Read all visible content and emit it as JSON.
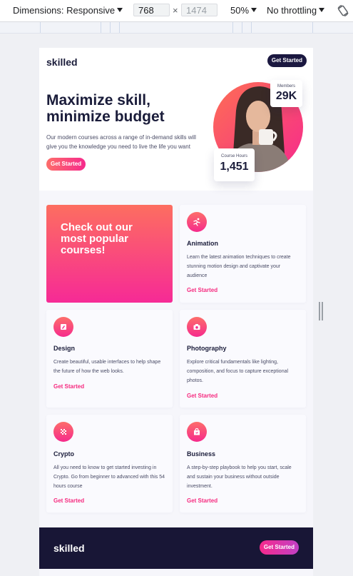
{
  "devtools": {
    "dimensions_label": "Dimensions: Responsive",
    "width_value": "768",
    "height_value": "1474",
    "times_symbol": "×",
    "zoom": "50%",
    "throttling": "No throttling"
  },
  "site": {
    "logo": "skilled",
    "header_cta": "Get Started"
  },
  "hero": {
    "title": "Maximize skill, minimize budget",
    "text": "Our modern courses across a range of in-demand skills will give you the knowledge you need to live the life you want",
    "cta": "Get Started",
    "stats": {
      "members_label": "Members",
      "members_value": "29K",
      "hours_label": "Course Hours",
      "hours_value": "1,451"
    }
  },
  "promo": {
    "title": "Check out our most popular courses!"
  },
  "courses": [
    {
      "title": "Animation",
      "text": "Learn the latest animation techniques to create stunning motion design and captivate your audience",
      "link": "Get Started"
    },
    {
      "title": "Design",
      "text": "Create beautiful, usable interfaces to help shape the future of how the web looks.",
      "link": "Get Started"
    },
    {
      "title": "Photography",
      "text": "Explore critical fundamentals like lighting, composition, and focus to capture exceptional photos.",
      "link": "Get Started"
    },
    {
      "title": "Crypto",
      "text": "All you need to know to get started investing in Crypto. Go from beginner to advanced with this 54 hours course",
      "link": "Get Started"
    },
    {
      "title": "Business",
      "text": "A step-by-step playbook to help you start, scale and sustain your business without outside investment.",
      "link": "Get Started"
    }
  ],
  "footer": {
    "logo": "skilled",
    "cta": "Get Started"
  },
  "colors": {
    "navy": "#1b1840",
    "pink": "#f62a8c",
    "coral": "#fd6e6a",
    "link_pink": "#f62a7f",
    "footer_bg": "#181636"
  },
  "icons": [
    "animation-runner-icon",
    "design-pen-icon",
    "photography-camera-icon",
    "crypto-grid-icon",
    "business-bag-icon",
    "rotate-device-icon"
  ]
}
